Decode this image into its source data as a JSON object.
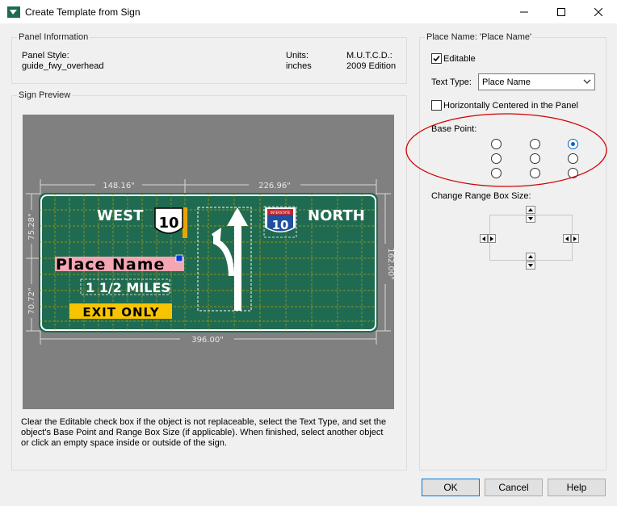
{
  "window": {
    "title": "Create Template from Sign",
    "minimize_icon": "minimize-icon",
    "maximize_icon": "maximize-icon",
    "close_icon": "close-icon"
  },
  "panel_info": {
    "title": "Panel Information",
    "style_label": "Panel Style:",
    "style_value": "guide_fwy_overhead",
    "units_label": "Units:",
    "units_value": "inches",
    "mutcd_label": "M.U.T.C.D.:",
    "mutcd_value": "2009 Edition"
  },
  "sign_preview": {
    "title": "Sign Preview",
    "sign": {
      "west": "WEST",
      "us_route": "10",
      "interstate_route": "10",
      "interstate_banner": "INTERSTATE",
      "north": "NORTH",
      "place_name": "Place Name",
      "distance": "1 1/2 MILES",
      "exit_only": "EXIT ONLY",
      "dim_top_left": "148.16\"",
      "dim_top_right": "226.96\"",
      "dim_bottom": "396.00\"",
      "dim_left_top": "75.28\"",
      "dim_left_bottom": "70.72\"",
      "dim_right": "162.00\"",
      "colors": {
        "sign_green": "#1f6b52",
        "place_name_highlight": "#f4a6b4",
        "exit_only_yellow": "#f7c500",
        "interstate_blue": "#1f4fa0",
        "interstate_red": "#c8232c"
      }
    },
    "help_text": "Clear the Editable check box if the object is not replaceable, select the Text Type, and set the object's Base Point and Range Box Size (if applicable). When finished, select another object or click an empty space inside or outside of the sign."
  },
  "place_panel": {
    "title": "Place Name: 'Place Name'",
    "editable_label": "Editable",
    "editable_checked": true,
    "text_type_label": "Text Type:",
    "text_type_value": "Place Name",
    "hcenter_label": "Horizontally Centered in the Panel",
    "hcenter_checked": false,
    "base_point_label": "Base Point:",
    "base_point_selected": "top-right",
    "range_box_label": "Change Range Box Size:",
    "highlight_color": "#d00000"
  },
  "buttons": {
    "ok": "OK",
    "cancel": "Cancel",
    "help": "Help"
  }
}
